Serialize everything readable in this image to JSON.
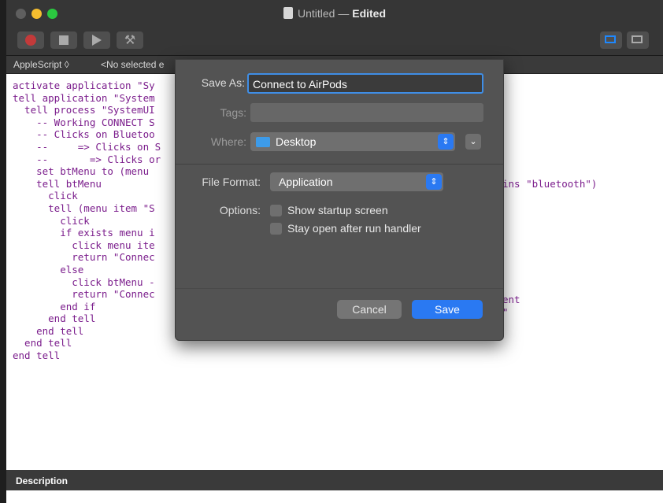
{
  "window": {
    "title_doc": "Untitled",
    "title_sep": " — ",
    "title_state": "Edited"
  },
  "navbar": {
    "language": "AppleScript ◊",
    "selection": "<No selected e"
  },
  "editor": {
    "code": "activate application \"Sy\ntell application \"System\n  tell process \"SystemUI\n    -- Working CONNECT S\n    -- Clicks on Bluetoo\n    --     => Clicks on S\n    --       => Clicks or\n    set btMenu to (menu\n    tell btMenu\n      click\n      tell (menu item \"S\n        click\n        if exists menu i\n          click menu ite\n          return \"Connec\n        else\n          click btMenu -\n          return \"Connec\n        end if\n      end tell\n    end tell\n  end tell\nend tell",
    "right_fragment_1": "ins \"bluetooth\")",
    "right_fragment_2": "ent\n\""
  },
  "description": {
    "label": "Description"
  },
  "dialog": {
    "save_as_label": "Save As:",
    "save_as_value": "Connect to AirPods",
    "tags_label": "Tags:",
    "where_label": "Where:",
    "where_value": "Desktop",
    "file_format_label": "File Format:",
    "file_format_value": "Application",
    "options_label": "Options:",
    "option_startup": "Show startup screen",
    "option_stay_open": "Stay open after run handler",
    "cancel_label": "Cancel",
    "save_label": "Save"
  },
  "colors": {
    "accent": "#2a79f2",
    "code": "#7b1d8c",
    "dialog_bg": "#535353"
  },
  "icons": [
    "close-icon",
    "minimize-icon",
    "maximize-icon",
    "record-icon",
    "stop-icon",
    "run-icon",
    "compile-icon",
    "folder-icon",
    "stepper-icon",
    "chevron-down-icon"
  ]
}
